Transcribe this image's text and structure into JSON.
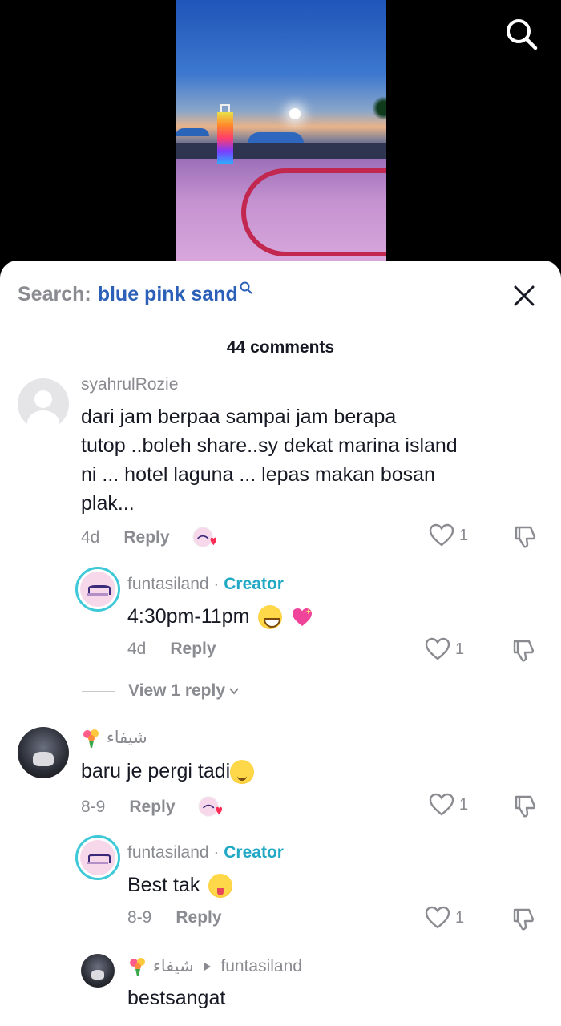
{
  "header": {
    "search_label": "Search:",
    "search_query": "blue pink sand"
  },
  "comments_count": "44 comments",
  "comments": [
    {
      "username": "syahrulRozie",
      "text_lines": [
        "dari jam berpaa sampai jam berapa",
        "tutop ..boleh share..sy dekat marina island",
        "ni ... hotel laguna ... lepas makan bosan",
        "plak..."
      ],
      "time": "4d",
      "reply_label": "Reply",
      "likes": "1",
      "reply": {
        "username": "funtasiland",
        "separator": "·",
        "creator_label": "Creator",
        "text": "4:30pm-11pm",
        "time": "4d",
        "reply_label": "Reply",
        "likes": "1"
      },
      "view_replies": "View 1 reply"
    },
    {
      "username": "شيفاء",
      "text": "baru je pergi tadi",
      "time": "8-9",
      "reply_label": "Reply",
      "likes": "1",
      "reply": {
        "username": "funtasiland",
        "separator": "·",
        "creator_label": "Creator",
        "text": "Best tak",
        "time": "8-9",
        "reply_label": "Reply",
        "likes": "1"
      },
      "reply2": {
        "username": "شيفاء",
        "reply_to": "funtasiland",
        "text": "bestsangat"
      }
    }
  ],
  "colors": {
    "accent_blue": "#2c5fb8",
    "creator_teal": "#20a8c4",
    "muted_gray": "#8a8b91"
  }
}
